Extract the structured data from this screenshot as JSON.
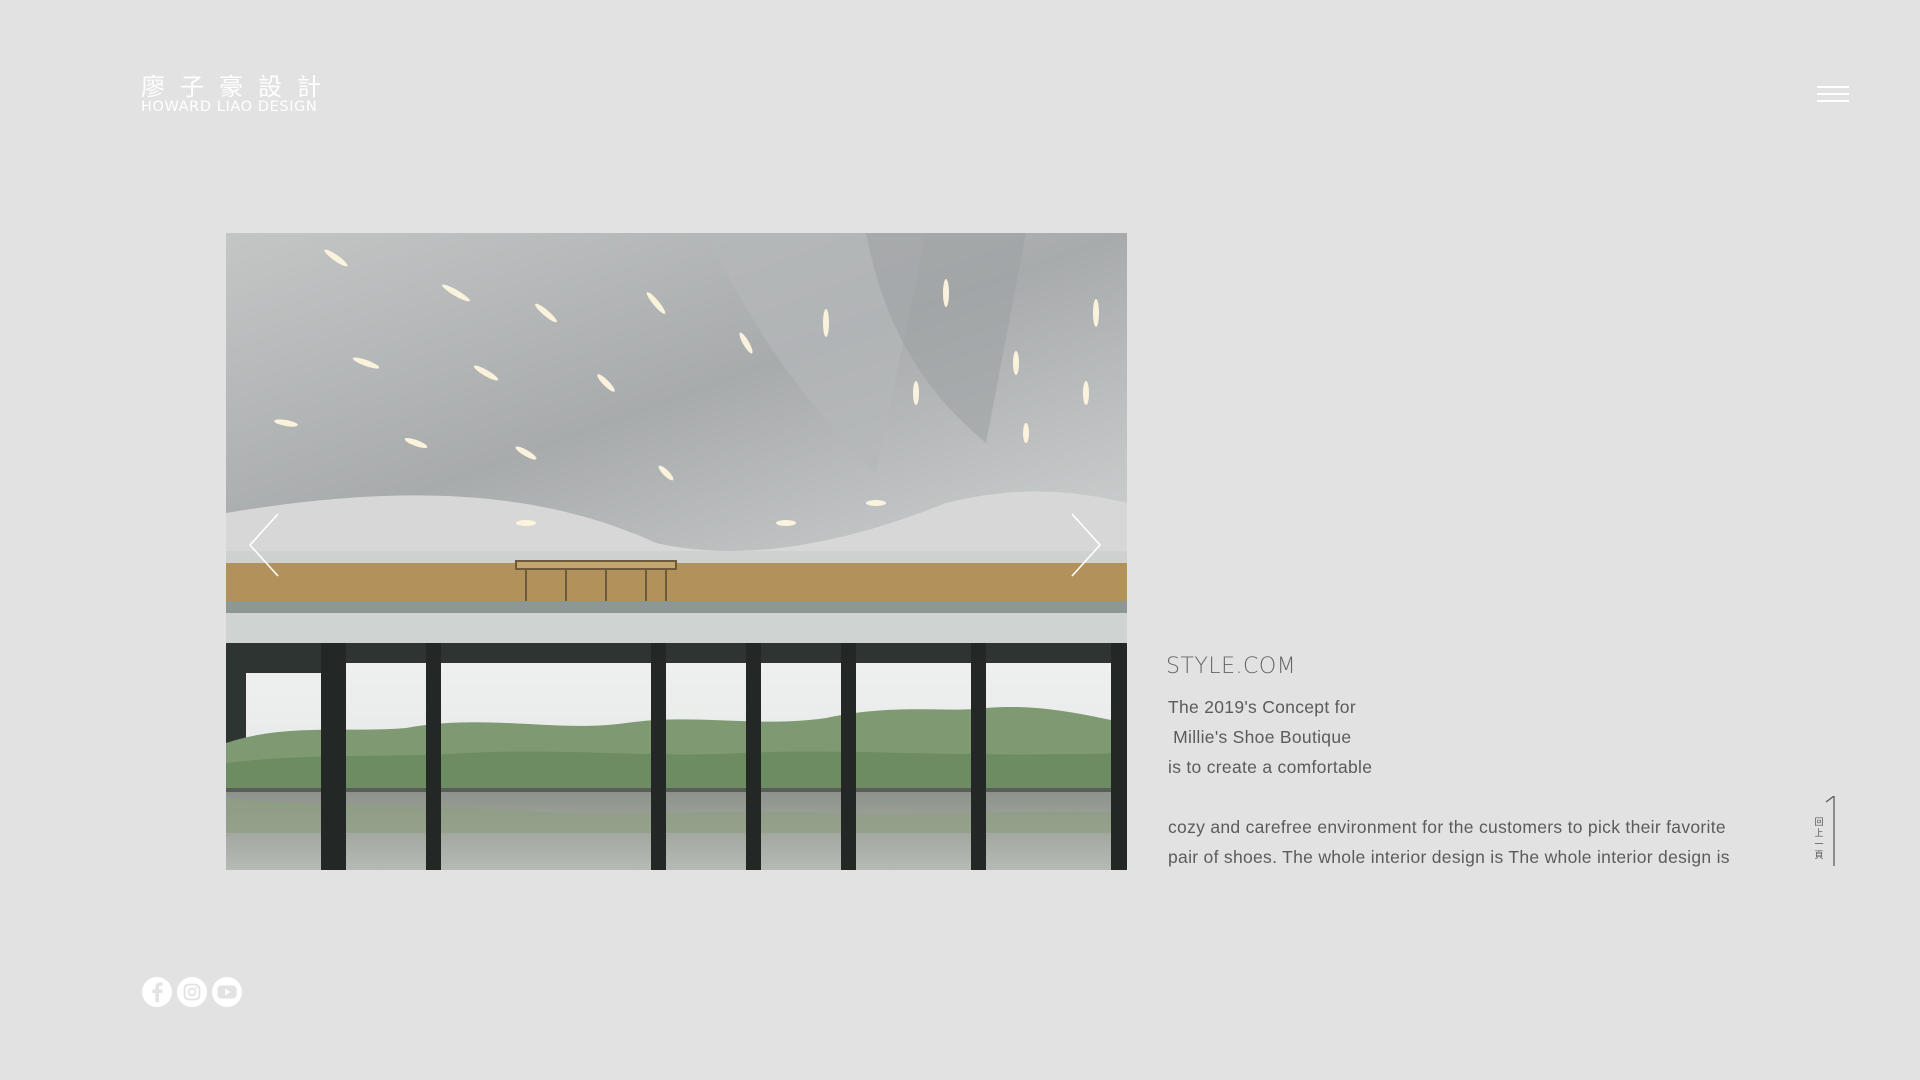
{
  "logo": {
    "zh": "廖子豪設計",
    "en": "HOWARD LIAO DESIGN"
  },
  "project": {
    "title": "STYLE.COM",
    "lines": [
      "The 2019's Concept for",
      " Millie's Shoe Boutique",
      "is to create a comfortable"
    ],
    "lines2": [
      "cozy and carefree environment for the customers to pick their favorite",
      "pair of shoes. The whole interior design is The whole interior design is"
    ]
  },
  "back": {
    "label": "回上一頁"
  },
  "icons": {
    "menu": "hamburger-icon",
    "prev": "chevron-left-icon",
    "next": "chevron-right-icon",
    "facebook": "facebook-icon",
    "instagram": "instagram-icon",
    "youtube": "youtube-icon"
  },
  "colors": {
    "background": "#e2e2e2",
    "logo": "#ffffff",
    "text": "#5b5b5b"
  }
}
